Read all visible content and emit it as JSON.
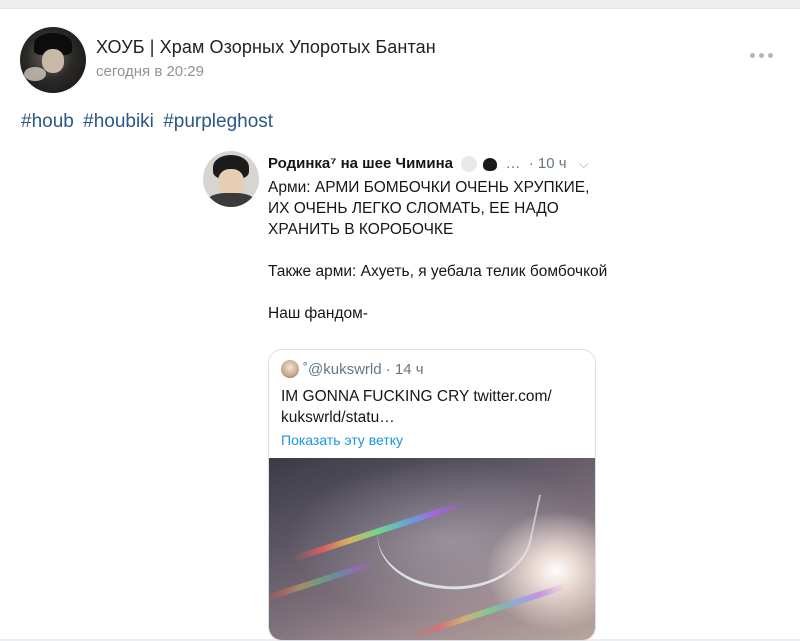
{
  "post": {
    "author": "ХОУБ | Храм Озорных Упоротых Бантан",
    "time": "сегодня в 20:29",
    "hashtags": [
      "#houb",
      "#houbiki",
      "#purpleghost"
    ]
  },
  "tweet": {
    "name": "Родинка⁷ на шее Чимина",
    "ellipsis": "…",
    "age": "· 10 ч",
    "chevron": "⌵",
    "paragraphs": [
      "Арми: АРМИ БОМБОЧКИ ОЧЕНЬ ХРУПКИЕ, ИХ ОЧЕНЬ ЛЕГКО СЛОМАТЬ, ЕЕ НАДО ХРАНИТЬ В КОРОБОЧКЕ",
      "Также арми: Ахуеть, я уебала телик бомбочкой",
      "Наш фандом-"
    ],
    "quote": {
      "handle": "˚@kukswrld · 14 ч",
      "text": "IM GONNA FUCKING CRY twitter.com/ kukswrld/statu…",
      "link": "Показать эту ветку"
    }
  },
  "icons": {
    "more": "more-horizontal-icon",
    "chevron": "chevron-down-icon"
  }
}
